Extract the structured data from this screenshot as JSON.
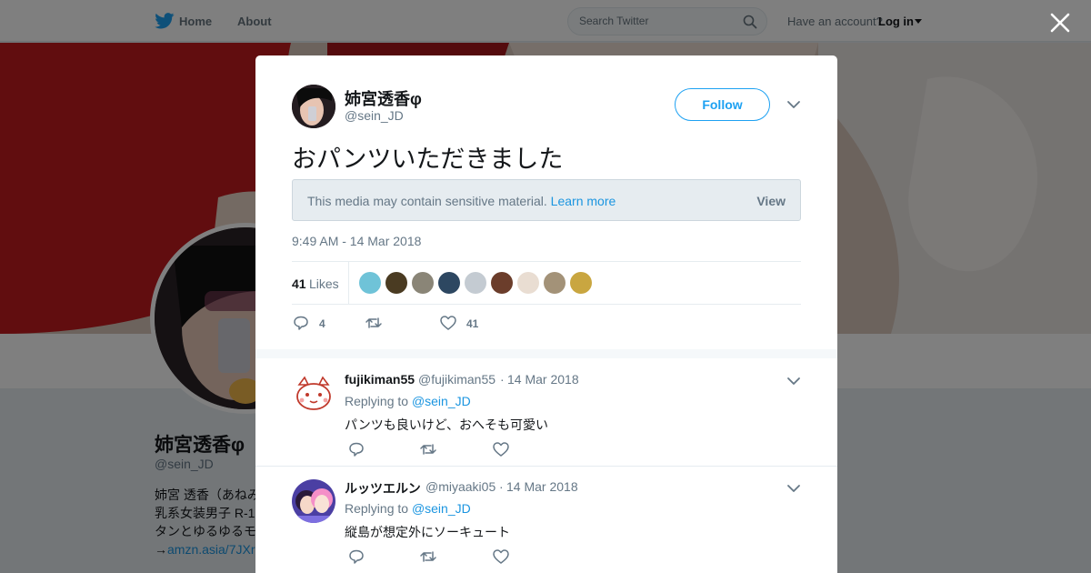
{
  "nav": {
    "home_label": "Home",
    "about_label": "About",
    "search_placeholder": "Search Twitter",
    "have_account": "Have an account?",
    "login_label": "Log in"
  },
  "background_profile": {
    "name": "姉宮透香φ",
    "handle": "@sein_JD",
    "bio_lines": [
      "姉宮 透香（あねみ",
      "乳系女装男子 R-1",
      "タンとゆるゆるモ"
    ],
    "bio_link": "amzn.asia/7JXr",
    "bio_link_prefix": "→"
  },
  "tweet": {
    "author_name": "姉宮透香φ",
    "author_handle": "@sein_JD",
    "follow_label": "Follow",
    "text": "おパンツいただきました",
    "sensitive_text": "This media may contain sensitive material.",
    "learn_more": "Learn more",
    "view_label": "View",
    "timestamp": "9:49 AM - 14 Mar 2018",
    "likes_count": "41",
    "likes_label": "Likes",
    "reply_count": "4",
    "like_count": "41"
  },
  "replies": [
    {
      "name": "fujikiman55",
      "handle": "@fujikiman55",
      "date": "14 Mar 2018",
      "replying_to_label": "Replying to",
      "replying_to": "@sein_JD",
      "text": "パンツも良いけど、おへそも可愛い"
    },
    {
      "name": "ルッツエルン",
      "handle": "@miyaaki05",
      "date": "14 Mar 2018",
      "replying_to_label": "Replying to",
      "replying_to": "@sein_JD",
      "text": "縦島が想定外にソーキュート"
    }
  ],
  "colors": {
    "accent": "#1da1f2",
    "link": "#1b95e0",
    "muted": "#657786",
    "overlay": "rgba(0,0,0,0.5)"
  },
  "icons": [
    "twitter-bird-icon",
    "search-icon",
    "caret-down-icon",
    "close-icon",
    "chevron-down-icon",
    "reply-icon",
    "retweet-icon",
    "heart-icon"
  ]
}
